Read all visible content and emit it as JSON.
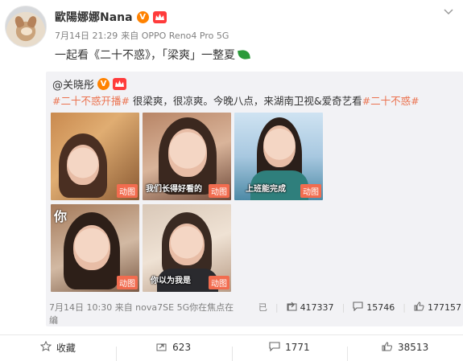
{
  "post": {
    "author": "歐陽娜娜Nana",
    "verified_badge": "V",
    "meta": {
      "time": "7月14日 21:29",
      "source": "来自 OPPO Reno4 Pro 5G"
    },
    "content": "一起看《二十不惑》，「梁爽」一整夏"
  },
  "repost": {
    "author": "@关晓彤",
    "verified_badge": "V",
    "text_parts": [
      {
        "text": "#二十不惑开播#",
        "type": "hashtag"
      },
      {
        "text": " 很梁爽，很凉爽。今晚八点，来湖南卫视&爱奇艺看",
        "type": "text"
      },
      {
        "text": "#二十不惑#",
        "type": "hashtag"
      }
    ],
    "thumbnails": [
      {
        "caption": "",
        "badge": "动图"
      },
      {
        "caption": "我们长得好看的",
        "badge": "动图"
      },
      {
        "caption": "上班能完成",
        "badge": "动图"
      },
      {
        "caption": "",
        "big_char": "你",
        "badge": "动图"
      },
      {
        "caption": "你以为我是",
        "badge": "动图"
      }
    ],
    "footer": {
      "time_line1": "7月14日 10:30 来自 nova7SE 5G你在焦点在",
      "time_line2": "编",
      "edit_label": "已",
      "shares": "417337",
      "comments": "15746",
      "likes": "177157"
    }
  },
  "actions": {
    "favorite": "收藏",
    "repost": "623",
    "comment": "1771",
    "like": "38513"
  },
  "colors": {
    "hashtag": "#eb7350",
    "verified": "#ff8200",
    "gif_badge": "#f26c4f",
    "repost_bg": "#f2f2f5"
  }
}
